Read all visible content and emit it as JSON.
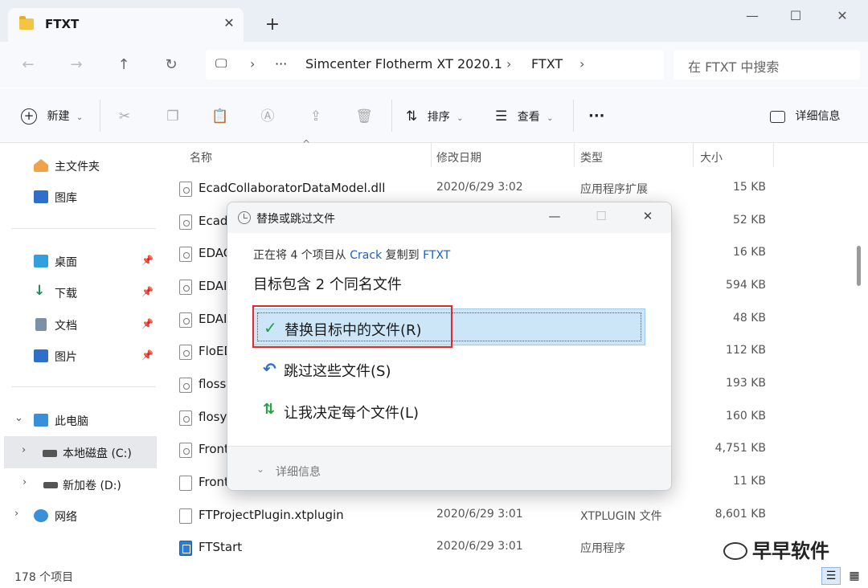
{
  "window": {
    "tab_title": "FTXT",
    "new_tab": "+",
    "minimize": "—",
    "maximize": "☐",
    "close": "✕"
  },
  "address": {
    "breadcrumb": [
      "Simcenter Flotherm XT 2020.1",
      "FTXT"
    ],
    "more": "···",
    "search_placeholder": "在 FTXT 中搜索"
  },
  "toolbar": {
    "new_label": "新建",
    "sort_label": "排序",
    "view_label": "查看",
    "more": "···",
    "details_label": "详细信息"
  },
  "sidebar": {
    "quick": [
      {
        "label": "主文件夹"
      },
      {
        "label": "图库"
      }
    ],
    "pinned": [
      {
        "label": "桌面"
      },
      {
        "label": "下载"
      },
      {
        "label": "文档"
      },
      {
        "label": "图片"
      }
    ],
    "this_pc": "此电脑",
    "drive_c": "本地磁盘 (C:)",
    "drive_d": "新加卷 (D:)",
    "network": "网络"
  },
  "list": {
    "headers": {
      "name": "名称",
      "date": "修改日期",
      "type": "类型",
      "size": "大小"
    },
    "rows": [
      {
        "name": "EcadCollaboratorDataModel.dll",
        "date": "2020/6/29 3:02",
        "type": "应用程序扩展",
        "size": "15 KB"
      },
      {
        "name": "Ecad",
        "date": "",
        "type": "",
        "size": "52 KB"
      },
      {
        "name": "EDAC",
        "date": "",
        "type": "",
        "size": "16 KB"
      },
      {
        "name": "EDAI",
        "date": "",
        "type": "",
        "size": "594 KB"
      },
      {
        "name": "EDAI",
        "date": "",
        "type": "",
        "size": "48 KB"
      },
      {
        "name": "FloED",
        "date": "",
        "type": "",
        "size": "112 KB"
      },
      {
        "name": "flossy",
        "date": "",
        "type": "",
        "size": "193 KB"
      },
      {
        "name": "flosy",
        "date": "",
        "type": "",
        "size": "160 KB"
      },
      {
        "name": "Front",
        "date": "",
        "type": "",
        "size": "4,751 KB"
      },
      {
        "name": "Front",
        "date": "",
        "type": "",
        "size": "11 KB"
      },
      {
        "name": "FTProjectPlugin.xtplugin",
        "date": "2020/6/29 3:01",
        "type": "XTPLUGIN 文件",
        "size": "8,601 KB"
      },
      {
        "name": "FTStart",
        "date": "2020/6/29 3:01",
        "type": "应用程序",
        "size": ""
      }
    ]
  },
  "status": {
    "count": "178 个项目"
  },
  "dialog": {
    "title": "替换或跳过文件",
    "line1_prefix": "正在将 4 个项目从 ",
    "line1_src": "Crack",
    "line1_mid": " 复制到 ",
    "line1_dst": "FTXT",
    "line2": "目标包含 2 个同名文件",
    "opt_replace": "替换目标中的文件(R)",
    "opt_skip": "跳过这些文件(S)",
    "opt_decide": "让我决定每个文件(L)",
    "details": "详细信息"
  },
  "watermark": "早早软件",
  "colors": {
    "accent": "#1f5fbf",
    "highlight": "#cde6f7",
    "annotation": "#e0282e"
  }
}
